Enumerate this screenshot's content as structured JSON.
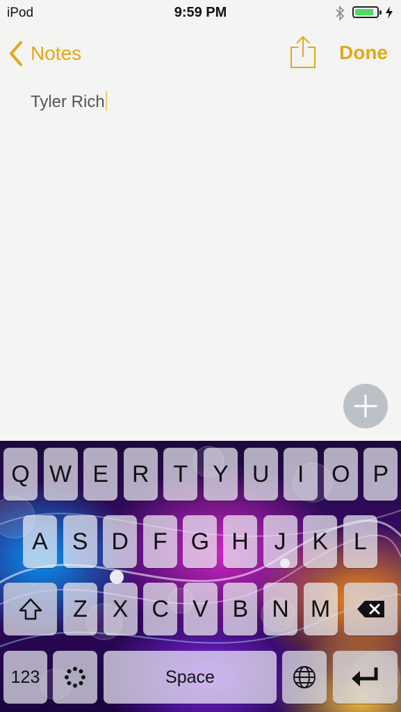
{
  "status_bar": {
    "carrier": "iPod",
    "time": "9:59 PM",
    "battery_level": 0.85,
    "charging": true,
    "bluetooth": true
  },
  "nav": {
    "back_label": "Notes",
    "done_label": "Done",
    "accent_color": "#e3a81a",
    "share_icon": "share-icon"
  },
  "note": {
    "text": "Tyler Rich"
  },
  "new_note_button": {
    "icon": "plus-icon"
  },
  "keyboard": {
    "row1": [
      "Q",
      "W",
      "E",
      "R",
      "T",
      "Y",
      "U",
      "I",
      "O",
      "P"
    ],
    "row2": [
      "A",
      "S",
      "D",
      "F",
      "G",
      "H",
      "J",
      "K",
      "L"
    ],
    "row3": [
      "Z",
      "X",
      "C",
      "V",
      "B",
      "N",
      "M"
    ],
    "numbers_label": "123",
    "space_label": "Space",
    "shift_icon": "shift-arrow-icon",
    "delete_icon": "backspace-icon",
    "emoji_icon": "dots-circle-icon",
    "globe_icon": "globe-icon",
    "return_icon": "return-arrow-icon"
  }
}
